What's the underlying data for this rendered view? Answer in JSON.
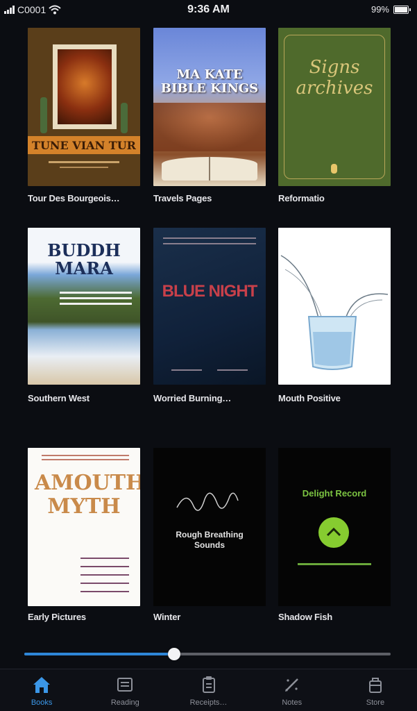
{
  "status_bar": {
    "carrier": "C0001",
    "time": "9:36 AM",
    "battery_text": "99%"
  },
  "books": [
    {
      "title": "Tour Des Bourgeois…",
      "cover_title": "TUNE VIAN TUR"
    },
    {
      "title": "Travels Pages",
      "cover_title": "MA KATE BIBLE KINGS"
    },
    {
      "title": "Reformatio",
      "cover_title": "Signs archives"
    },
    {
      "title": "Southern West",
      "cover_title": "BUDDH MARA"
    },
    {
      "title": "Worried Burning…",
      "cover_title": "BLUE NIGHT"
    },
    {
      "title": "Mouth Positive",
      "cover_title": ""
    },
    {
      "title": "Early Pictures",
      "cover_title": "AMOUTH MYTH"
    },
    {
      "title": "Winter",
      "cover_title": "Rough Breathing Sounds"
    },
    {
      "title": "Shadow Fish",
      "cover_title": "Delight Record"
    }
  ],
  "progress": {
    "value": 0.41
  },
  "tabs": [
    {
      "label": "Books",
      "icon": "home-icon",
      "active": true
    },
    {
      "label": "Reading",
      "icon": "book-icon",
      "active": false
    },
    {
      "label": "Receipts…",
      "icon": "clipboard-icon",
      "active": false
    },
    {
      "label": "Notes",
      "icon": "pen-icon",
      "active": false
    },
    {
      "label": "Store",
      "icon": "bag-icon",
      "active": false
    }
  ],
  "colors": {
    "accent": "#3b97e8",
    "background": "#0b0d12"
  }
}
